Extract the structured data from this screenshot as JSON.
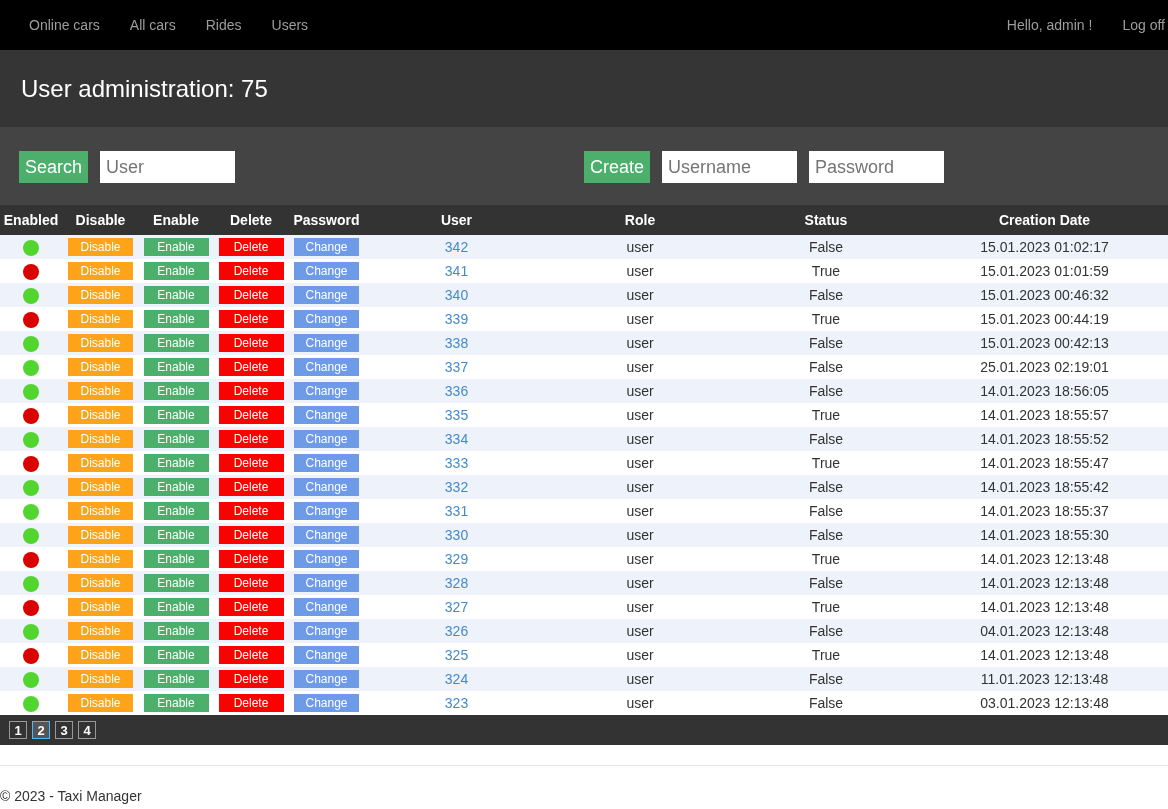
{
  "nav": {
    "links": [
      "Online cars",
      "All cars",
      "Rides",
      "Users"
    ],
    "greeting": "Hello, admin !",
    "logoff": "Log off"
  },
  "title": "User administration: 75",
  "search": {
    "button": "Search",
    "placeholder": "User"
  },
  "create": {
    "button": "Create",
    "username_placeholder": "Username",
    "password_placeholder": "Password"
  },
  "table": {
    "columns": [
      "Enabled",
      "Disable",
      "Enable",
      "Delete",
      "Password",
      "User",
      "Role",
      "Status",
      "Creation Date"
    ],
    "rows": [
      {
        "enabled": true,
        "disable": "Disable",
        "enable": "Enable",
        "delete": "Delete",
        "password": "Change",
        "user": "342",
        "role": "user",
        "status": "False",
        "created": "15.01.2023 01:02:17"
      },
      {
        "enabled": false,
        "disable": "Disable",
        "enable": "Enable",
        "delete": "Delete",
        "password": "Change",
        "user": "341",
        "role": "user",
        "status": "True",
        "created": "15.01.2023 01:01:59"
      },
      {
        "enabled": true,
        "disable": "Disable",
        "enable": "Enable",
        "delete": "Delete",
        "password": "Change",
        "user": "340",
        "role": "user",
        "status": "False",
        "created": "15.01.2023 00:46:32"
      },
      {
        "enabled": false,
        "disable": "Disable",
        "enable": "Enable",
        "delete": "Delete",
        "password": "Change",
        "user": "339",
        "role": "user",
        "status": "True",
        "created": "15.01.2023 00:44:19"
      },
      {
        "enabled": true,
        "disable": "Disable",
        "enable": "Enable",
        "delete": "Delete",
        "password": "Change",
        "user": "338",
        "role": "user",
        "status": "False",
        "created": "15.01.2023 00:42:13"
      },
      {
        "enabled": true,
        "disable": "Disable",
        "enable": "Enable",
        "delete": "Delete",
        "password": "Change",
        "user": "337",
        "role": "user",
        "status": "False",
        "created": "25.01.2023 02:19:01"
      },
      {
        "enabled": true,
        "disable": "Disable",
        "enable": "Enable",
        "delete": "Delete",
        "password": "Change",
        "user": "336",
        "role": "user",
        "status": "False",
        "created": "14.01.2023 18:56:05"
      },
      {
        "enabled": false,
        "disable": "Disable",
        "enable": "Enable",
        "delete": "Delete",
        "password": "Change",
        "user": "335",
        "role": "user",
        "status": "True",
        "created": "14.01.2023 18:55:57"
      },
      {
        "enabled": true,
        "disable": "Disable",
        "enable": "Enable",
        "delete": "Delete",
        "password": "Change",
        "user": "334",
        "role": "user",
        "status": "False",
        "created": "14.01.2023 18:55:52"
      },
      {
        "enabled": false,
        "disable": "Disable",
        "enable": "Enable",
        "delete": "Delete",
        "password": "Change",
        "user": "333",
        "role": "user",
        "status": "True",
        "created": "14.01.2023 18:55:47"
      },
      {
        "enabled": true,
        "disable": "Disable",
        "enable": "Enable",
        "delete": "Delete",
        "password": "Change",
        "user": "332",
        "role": "user",
        "status": "False",
        "created": "14.01.2023 18:55:42"
      },
      {
        "enabled": true,
        "disable": "Disable",
        "enable": "Enable",
        "delete": "Delete",
        "password": "Change",
        "user": "331",
        "role": "user",
        "status": "False",
        "created": "14.01.2023 18:55:37"
      },
      {
        "enabled": true,
        "disable": "Disable",
        "enable": "Enable",
        "delete": "Delete",
        "password": "Change",
        "user": "330",
        "role": "user",
        "status": "False",
        "created": "14.01.2023 18:55:30"
      },
      {
        "enabled": false,
        "disable": "Disable",
        "enable": "Enable",
        "delete": "Delete",
        "password": "Change",
        "user": "329",
        "role": "user",
        "status": "True",
        "created": "14.01.2023 12:13:48"
      },
      {
        "enabled": true,
        "disable": "Disable",
        "enable": "Enable",
        "delete": "Delete",
        "password": "Change",
        "user": "328",
        "role": "user",
        "status": "False",
        "created": "14.01.2023 12:13:48"
      },
      {
        "enabled": false,
        "disable": "Disable",
        "enable": "Enable",
        "delete": "Delete",
        "password": "Change",
        "user": "327",
        "role": "user",
        "status": "True",
        "created": "14.01.2023 12:13:48"
      },
      {
        "enabled": true,
        "disable": "Disable",
        "enable": "Enable",
        "delete": "Delete",
        "password": "Change",
        "user": "326",
        "role": "user",
        "status": "False",
        "created": "04.01.2023 12:13:48"
      },
      {
        "enabled": false,
        "disable": "Disable",
        "enable": "Enable",
        "delete": "Delete",
        "password": "Change",
        "user": "325",
        "role": "user",
        "status": "True",
        "created": "14.01.2023 12:13:48"
      },
      {
        "enabled": true,
        "disable": "Disable",
        "enable": "Enable",
        "delete": "Delete",
        "password": "Change",
        "user": "324",
        "role": "user",
        "status": "False",
        "created": "11.01.2023 12:13:48"
      },
      {
        "enabled": true,
        "disable": "Disable",
        "enable": "Enable",
        "delete": "Delete",
        "password": "Change",
        "user": "323",
        "role": "user",
        "status": "False",
        "created": "03.01.2023 12:13:48"
      }
    ]
  },
  "pagination": [
    {
      "label": "1",
      "selected": false
    },
    {
      "label": "2",
      "selected": true
    },
    {
      "label": "3",
      "selected": false
    },
    {
      "label": "4",
      "selected": false
    }
  ],
  "footer": "© 2023 - Taxi Manager"
}
